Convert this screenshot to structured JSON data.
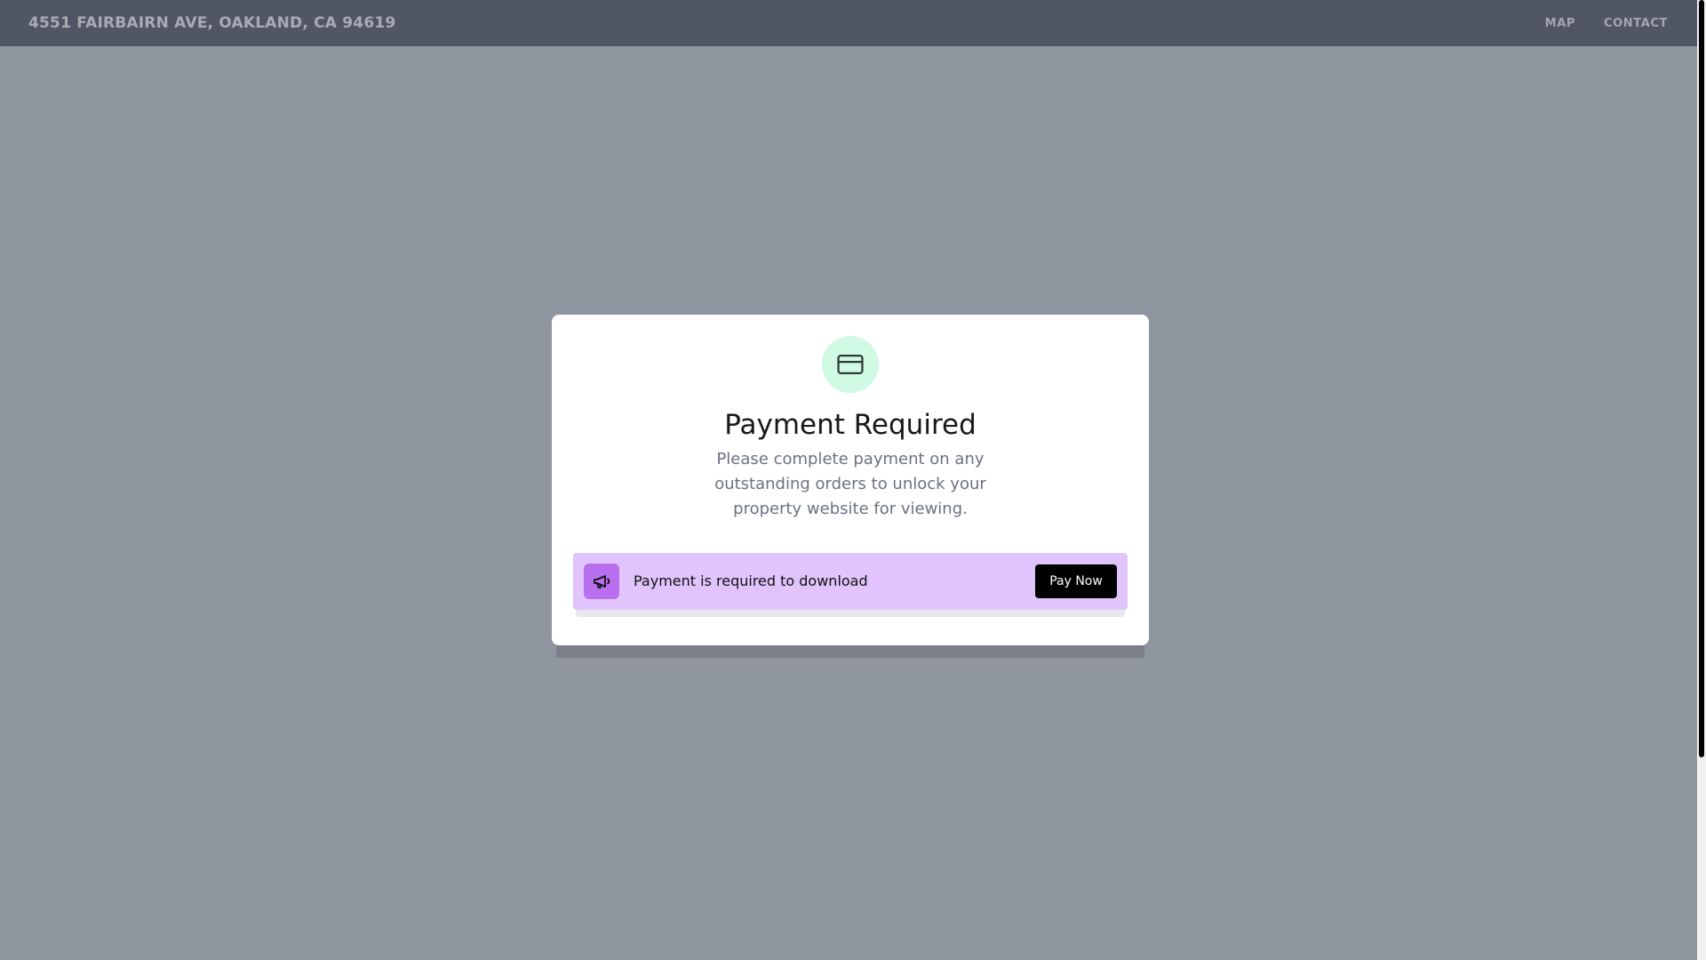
{
  "header": {
    "address": "4551 FAIRBAIRN AVE, OAKLAND, CA 94619",
    "nav": [
      {
        "label": "MAP"
      },
      {
        "label": "CONTACT"
      }
    ]
  },
  "modal": {
    "icon": "credit-card-icon",
    "title": "Payment Required",
    "description": "Please complete payment on any outstanding orders to unlock your property website for viewing.",
    "banner": {
      "icon": "megaphone-icon",
      "text": "Payment is required to download",
      "button_label": "Pay Now"
    }
  },
  "colors": {
    "icon_bg": "#d1fae5",
    "banner_bg": "#e0c4fb",
    "banner_icon_bg": "#b870f0",
    "header_bg": "#505663",
    "overlay_bg": "#9096a0"
  }
}
